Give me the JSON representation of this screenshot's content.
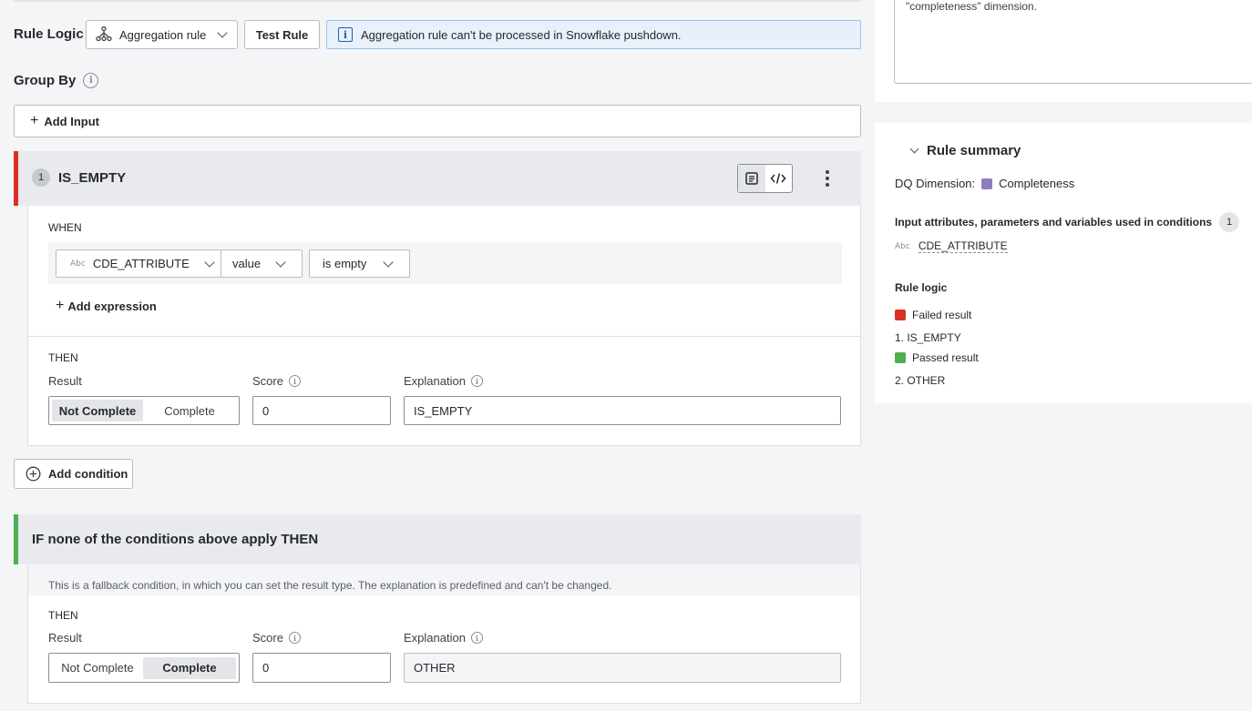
{
  "rule_logic": {
    "label": "Rule Logic",
    "type_dropdown": "Aggregation rule",
    "test_button": "Test Rule",
    "notice": "Aggregation rule can't be processed in Snowflake pushdown."
  },
  "group_by": {
    "label": "Group By",
    "add_input": "Add Input"
  },
  "condition1": {
    "number": "1",
    "name": "IS_EMPTY",
    "when_label": "WHEN",
    "expression": {
      "attribute_type": "Abc",
      "attribute": "CDE_ATTRIBUTE",
      "property": "value",
      "operator": "is empty"
    },
    "add_expression": "Add expression",
    "then_label": "THEN",
    "result_label": "Result",
    "result_options": [
      "Not Complete",
      "Complete"
    ],
    "result_selected": "Not Complete",
    "score_label": "Score",
    "score_value": "0",
    "explanation_label": "Explanation",
    "explanation_value": "IS_EMPTY"
  },
  "add_condition": "Add condition",
  "fallback": {
    "title": "IF none of the conditions above apply THEN",
    "description": "This is a fallback condition, in which you can set the result type. The explanation is predefined and can't be changed.",
    "then_label": "THEN",
    "result_label": "Result",
    "result_options": [
      "Not Complete",
      "Complete"
    ],
    "result_selected": "Complete",
    "score_label": "Score",
    "score_value": "0",
    "explanation_label": "Explanation",
    "explanation_value": "OTHER"
  },
  "right_panel": {
    "description_tail": "\"completeness\" dimension.",
    "summary_title": "Rule summary",
    "dq_dimension_label": "DQ Dimension:",
    "dq_dimension_value": "Completeness",
    "dq_dimension_color": "#8e7cc3",
    "inputs_label": "Input attributes, parameters and variables used in conditions",
    "inputs_count": "1",
    "input_type": "Abc",
    "input_name": "CDE_ATTRIBUTE",
    "rule_logic_label": "Rule logic",
    "failed_label": "Failed result",
    "failed_color": "#d93025",
    "failed_item": "1. IS_EMPTY",
    "passed_label": "Passed result",
    "passed_color": "#4caf50",
    "passed_item": "2. OTHER"
  },
  "colors": {
    "condition_accent": "#d93025",
    "fallback_accent": "#4caf50"
  }
}
